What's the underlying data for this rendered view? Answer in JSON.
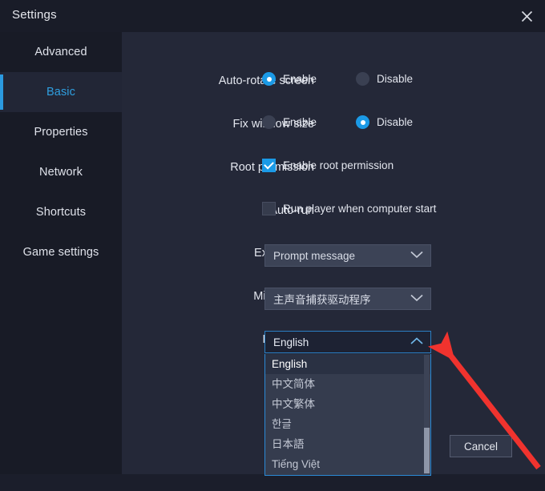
{
  "window": {
    "title": "Settings",
    "close_icon": "close-icon"
  },
  "sidebar": {
    "items": [
      {
        "label": "Advanced",
        "active": false
      },
      {
        "label": "Basic",
        "active": true
      },
      {
        "label": "Properties",
        "active": false
      },
      {
        "label": "Network",
        "active": false
      },
      {
        "label": "Shortcuts",
        "active": false
      },
      {
        "label": "Game settings",
        "active": false
      }
    ]
  },
  "settings": {
    "auto_rotate": {
      "label": "Auto-rotate screen",
      "enable_label": "Enable",
      "disable_label": "Disable",
      "selected": "Enable"
    },
    "fix_window": {
      "label": "Fix window size",
      "enable_label": "Enable",
      "disable_label": "Disable",
      "selected": "Disable"
    },
    "root_permission": {
      "label": "Root permission",
      "checkbox_label": "Enable root permission",
      "checked": true
    },
    "auto_run": {
      "label": "Auto-run",
      "checkbox_label": "Run player when computer start",
      "checked": false
    },
    "exit_options": {
      "label": "Exit options",
      "value": "Prompt message",
      "chevron": "chevron-down-icon"
    },
    "microphone": {
      "label": "Microphone",
      "value": "主声音捕获驱动程序",
      "chevron": "chevron-down-icon"
    },
    "language": {
      "label": "Language",
      "value": "English",
      "chevron": "chevron-up-icon",
      "expanded": true,
      "options": [
        {
          "label": "English",
          "selected": true
        },
        {
          "label": "中文简体",
          "selected": false
        },
        {
          "label": "中文繁体",
          "selected": false
        },
        {
          "label": "한글",
          "selected": false
        },
        {
          "label": "日本語",
          "selected": false
        },
        {
          "label": "Tiếng Việt",
          "selected": false
        }
      ]
    }
  },
  "footer": {
    "cancel_label": "Cancel"
  },
  "annotation": {
    "arrow_color": "#f0332e"
  },
  "colors": {
    "accent": "#1b9ae6",
    "sidebar_bg": "#181b26",
    "panel_bg": "#242838",
    "titlebar_bg": "#191c28"
  }
}
